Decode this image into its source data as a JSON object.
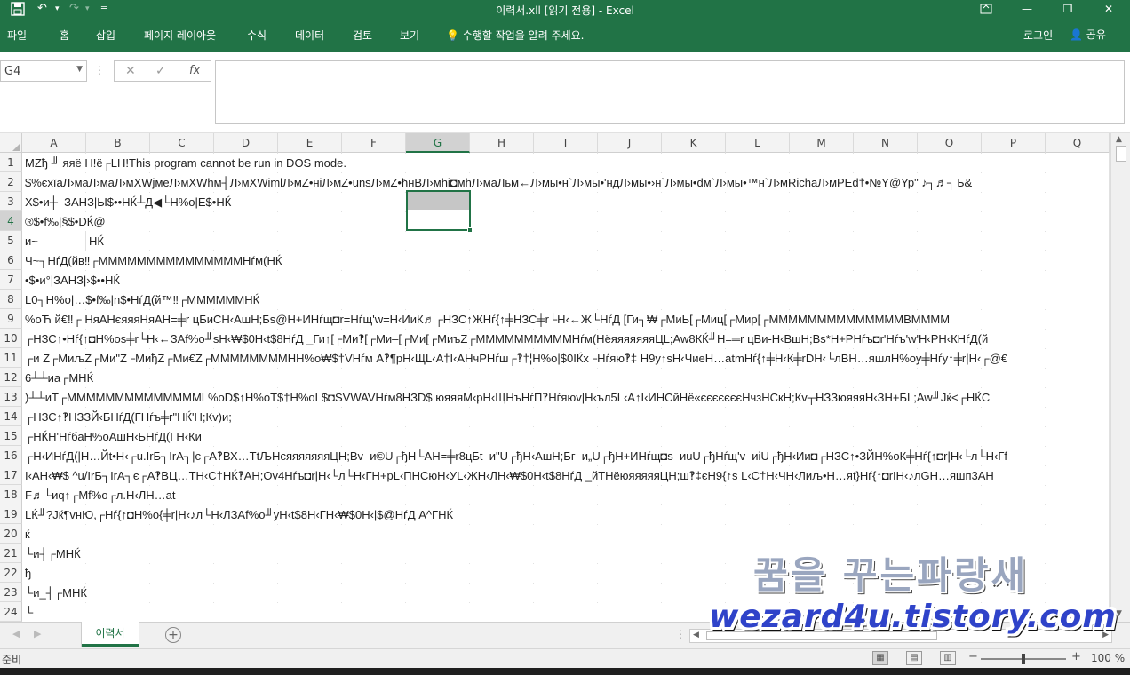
{
  "app": {
    "title": "이력서.xll  [읽기 전용] - Excel",
    "accent": "#217346"
  },
  "quick_access": [
    "save-icon",
    "undo-icon",
    "redo-icon",
    "customize-icon"
  ],
  "window_controls": [
    "ribbon-display-icon",
    "minimize-icon",
    "restore-icon",
    "close-icon"
  ],
  "ribbon": {
    "tabs": [
      "파일",
      "홈",
      "삽입",
      "페이지 레이아웃",
      "수식",
      "데이터",
      "검토",
      "보기"
    ],
    "tell_me": "수행할 작업을 알려 주세요.",
    "login": "로그인",
    "share": "공유"
  },
  "formula_bar": {
    "name_box": "G4",
    "cancel": "✕",
    "enter": "✓",
    "fx": "fx",
    "formula": ""
  },
  "sheet": {
    "selected_cell": "G4",
    "columns": [
      "A",
      "B",
      "C",
      "D",
      "E",
      "F",
      "G",
      "H",
      "I",
      "J",
      "K",
      "L",
      "M",
      "N",
      "O",
      "P",
      "Q"
    ],
    "rows": [
      "1",
      "2",
      "3",
      "4",
      "5",
      "6",
      "7",
      "8",
      "9",
      "10",
      "11",
      "12",
      "13",
      "14",
      "15",
      "16",
      "17",
      "18",
      "19",
      "20",
      "21",
      "22",
      "23",
      "24"
    ],
    "cells": {
      "A1": "MZђ ╜ яяё H!ё┌LH!This program cannot be run in DOS mode.",
      "A2": "$%єхїаЛ›маЛ›маЛ›мXWjмеЛ›мXWhм┤Л›мXWimlЛ›мZ•нiЛ›мZ•unsЛ›мZ•ћнВЛ›мhі◘мhЛ›маЛьм←Л›мы•н`Л›мы•'ндЛ›мы•›н`Л›мы•dм`Л›мы•™н`Л›мRichаЛ›мPEd†•№Y@Yp\" ♪┐♬┐Ъ&",
      "A3": "X$•и┼–ЗАНЗ|Ы$••НЌ┴Д◀└Н%о|Е$•НЌ",
      "A4": "®$•f‰|§$•DЌ@",
      "A5": "и~",
      "B5": "НЌ",
      "A6": "Ч~┐НѓД(йв‼┌МММММММММММММММНѓм(НЌ",
      "A7": "•$•и°|ЗАНЗ|›$••НЌ",
      "A8": "L0┐Н%о|…$•f‰|n$•НѓД(й™‼┌ММММММНЌ",
      "A9": "%оЋ й€‼┌ НяАНєяяяНяАН=╪r цБиСН‹АшН;Бѕ@Н+ИНѓщ◘r=Нѓщ'w=Н‹ИиК♬┌НЗС↑ЖНѓ{↑╪НЗС╪r└Н‹←Ж└НѓД [Ги┐₩┌МиЬ[┌Миц[┌Мир[┌ММММММММММММММВММММ",
      "A10": "┌НЗС↑•Нѓ{↑◘Н%оѕ╪r└Н‹←ЗАf%о╜ѕН‹₩$0Н‹t$8НѓД _Ги↑[┌Ми‽[┌Ми–[┌Ми[┌МиъZ┌ММММММММММНѓм(НёяяяяяяяЦL;Aw8КЌ╜Н=╪r цВи-Н‹ВшН;Вѕ*Н+РНѓъ◘r'Нѓъ'w'Н‹РН‹КНѓД(й",
      "A11": "┌и Z┌МиљZ┌Ми\"Z┌МиђZ┌Ми€Z┌ММММММММНН%о₩$†VНѓм А‽¶рН‹ЩL‹А†І‹АНчРНѓш┌‽†¦Н%о|$0ІЌх┌Нѓяю‽‡ Н9у↑ѕН‹ЧиеН…аtmНѓ{↑╪Н‹К╪rDН‹└лВН…яшлН%оу╪Нѓу↑╪r|Н‹┌@€",
      "A12": "6┴┴иа┌МНЌ",
      "A13": ")┴┴иТ┌ММММММММММММММL%оD$↑Н%оТ$†Н%оL$◘SVWAVНѓм8НЗD$ юяяяМ‹рН‹ЩНъНѓП‽Нѓяюv|Н‹ъл5L‹А↑І‹ИНСйНё«єєєєєєєНчзНСкН;Кv┬НЗЗюяяяН‹ЗН+БL;Aw╜Jќ<┌НЌС",
      "A14": "┌НЗС↑‽НЗЗЙ‹БНѓД(ГНѓъ╪r\"НЌ'Н;Кv)и;",
      "A15": "┌НЌН'НѓбаН%оАшН‹БНѓД(ГН‹Ки",
      "A16": "┌Н‹ИНѓД(|Н…Йt•Н‹┌u.IrБ┐IrА┐|є┌А‽ВХ…ТtЉНєяяяяяяяЦН;Вv–и©U┌ђН└АН=╪r8цБt–и\"U┌ђН‹АшН;Бг–и„U┌ђН+ИНѓщ◘ѕ–иuU┌ђНѓщ'v–иiU┌ђН‹Ии◘┌НЗС↑•ЗЙН%оК╪Нѓ{↑◘r|Н‹└л└Н‹Гf",
      "A17": "І‹АН‹₩$ ^u/IrБ┐IrА┐є┌А‽ВЦ…ТН‹С†НЌ‽АН;Ov4Нѓъ◘r|Н‹└л└Н‹ГН+рL‹ПНСюН‹УL‹ЖН‹ЛН‹₩$0Н‹t$8НѓД _йТНёюяяяяяЦН;ш‽‡єН9{↑ѕ L‹С†Н‹ЧН‹Лиљ•Н…яt}Нѓ{↑◘rІН‹♪лGН…яшп3АН",
      "A18": "F♬└иq↑┌Мf%о┌л.Н‹ЛН…аt",
      "A19": "LЌ╜?Jќ¶vнЮ,┌Нѓ{↑◘Н%о{╪r|Н‹♪л└Н‹ЛЗАf%о╜уН‹t$8Н‹ГН‹₩$0Н‹|$@НѓД А^ГНЌ",
      "A20": "ќ",
      "A21": "└и┤┌МНЌ",
      "A22": "ђ",
      "A23": "└и_┤┌МНЌ",
      "A24": "└"
    }
  },
  "sheet_tabs": {
    "active": "이력서",
    "add_label": "+",
    "prev": "◀",
    "next": "▶"
  },
  "status": {
    "ready": "준비",
    "zoom_out": "−",
    "zoom_in": "+",
    "zoom": "100 %",
    "zoom_fraction": 0.5
  },
  "watermark": {
    "line1": "꿈을 꾸는파랑새",
    "line2": "wezard4u.tistory.com"
  }
}
